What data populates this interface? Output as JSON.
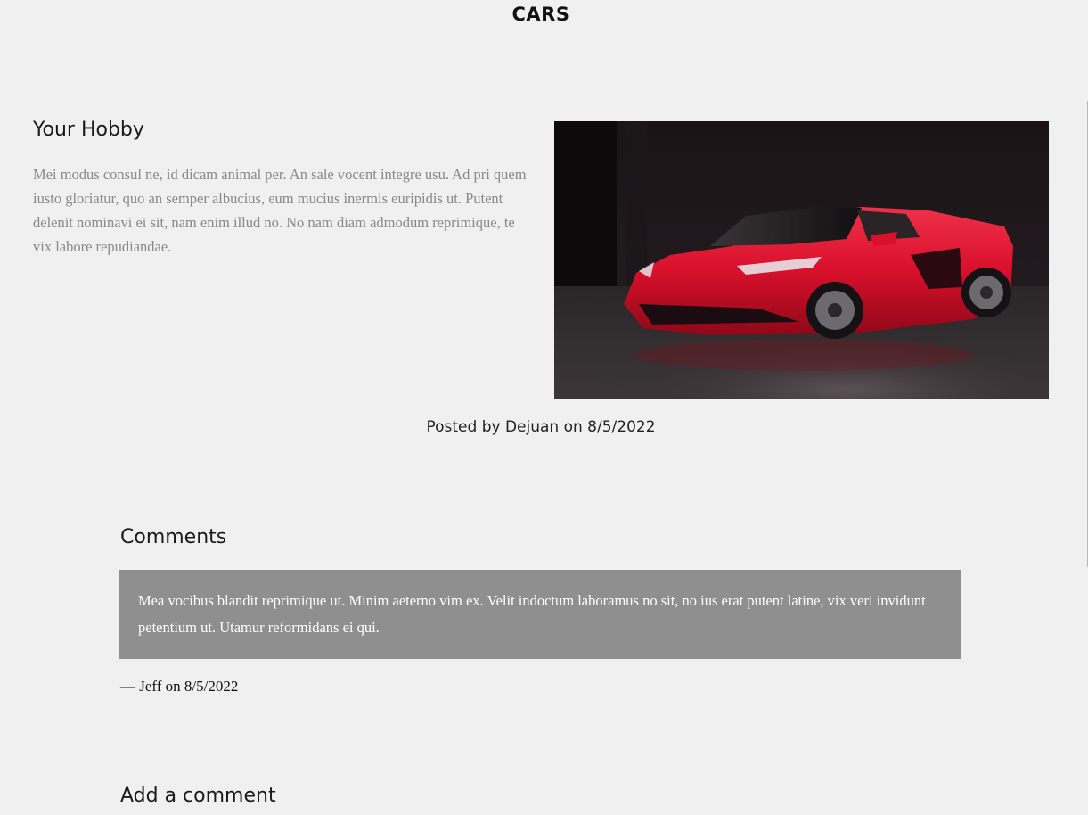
{
  "header": {
    "title": "CARS"
  },
  "post": {
    "title": "Your Hobby",
    "body": "Mei modus consul ne, id dicam animal per. An sale vocent integre usu. Ad pri quem iusto gloriatur, quo an semper albucius, eum mucius inermis euripidis ut. Putent delenit nominavi ei sit, nam enim illud no. No nam diam admodum reprimique, te vix labore repudiandae.",
    "image": {
      "subject": "red sports car",
      "icon": "car-photo"
    },
    "posted_by": "Posted by Dejuan on 8/5/2022"
  },
  "comments": {
    "title": "Comments",
    "items": [
      {
        "text": "Mea vocibus blandit reprimique ut. Minim aeterno vim ex. Velit indoctum laboramus no sit, no ius erat putent latine, vix veri invidunt petentium ut. Utamur reformidans ei qui.",
        "meta": "— Jeff on 8/5/2022"
      }
    ]
  },
  "add_comment": {
    "title": "Add a comment"
  },
  "colors": {
    "background": "#f1f0f0",
    "comment_box": "#8f8f8f",
    "body_text": "#888888",
    "car_red": "#d8102b"
  }
}
